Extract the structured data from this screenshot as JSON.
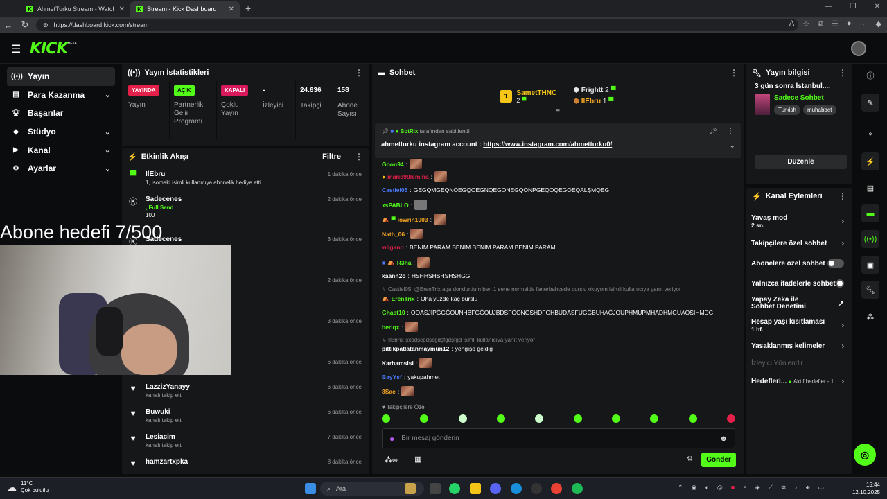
{
  "browser": {
    "tabs": [
      {
        "title": "AhmetTurku Stream - Watch Live",
        "active": false
      },
      {
        "title": "Stream - Kick Dashboard",
        "active": true
      }
    ],
    "url": "https://dashboard.kick.com/stream"
  },
  "brand": {
    "logo": "KICK",
    "beta": "BETA",
    "accent": "#53fc18"
  },
  "sidebar": {
    "items": [
      {
        "label": "Yayın",
        "icon": "broadcast-icon",
        "active": true,
        "chevron": false
      },
      {
        "label": "Para Kazanma",
        "icon": "money-icon",
        "chevron": true
      },
      {
        "label": "Başarılar",
        "icon": "trophy-icon",
        "chevron": false
      },
      {
        "label": "Stüdyo",
        "icon": "studio-icon",
        "chevron": true
      },
      {
        "label": "Kanal",
        "icon": "channel-icon",
        "chevron": true
      },
      {
        "label": "Ayarlar",
        "icon": "gear-icon",
        "chevron": true
      }
    ]
  },
  "stats": {
    "title": "Yayın İstatistikleri",
    "items": [
      {
        "value": "YAYINDA",
        "label": "Yayın",
        "badge": "red"
      },
      {
        "value": "AÇIK",
        "label": "Partnerlik Gelir Programı",
        "badge": "green"
      },
      {
        "value": "KAPALI",
        "label": "Çoklu Yayın",
        "badge": "red2"
      },
      {
        "value": "-",
        "label": "İzleyici"
      },
      {
        "value": "24.636",
        "label": "Takipçi"
      },
      {
        "value": "158",
        "label": "Abone Sayısı"
      }
    ]
  },
  "activity": {
    "title": "Etkinlik Akışı",
    "filter": "Filtre",
    "items": [
      {
        "name": "IlEbru",
        "desc": "1, isomaki isimli kullanıcıya abonelik hediye etti.",
        "time": "1 dakika önce",
        "icon": "gift-icon"
      },
      {
        "name": "Sadecenes",
        "desc": ", Full Send",
        "extra": "100",
        "time": "2 dakika önce",
        "icon": "kick-icon"
      },
      {
        "name": "Sadecenes",
        "desc": "",
        "time": "3 dakika önce",
        "icon": "kick-icon"
      },
      {
        "name": "",
        "desc": "",
        "time": "2 dakika önce",
        "icon": "heart-icon"
      },
      {
        "name": "",
        "desc": "",
        "time": "3 dakika önce",
        "icon": "heart-icon"
      },
      {
        "name": "",
        "desc": "kanalı takip etti",
        "time": "6 dakika önce",
        "icon": "heart-icon"
      },
      {
        "name": "LazzizYanayy",
        "desc": "kanalı takip etti",
        "time": "6 dakika önce",
        "icon": "heart-icon"
      },
      {
        "name": "Buwuki",
        "desc": "kanalı takip etti",
        "time": "6 dakika önce",
        "icon": "heart-icon"
      },
      {
        "name": "Lesiacim",
        "desc": "kanalı takip etti",
        "time": "7 dakika önce",
        "icon": "heart-icon"
      },
      {
        "name": "hamzartxpka",
        "desc": "",
        "time": "8 dakika önce",
        "icon": "heart-icon"
      }
    ]
  },
  "overlay": {
    "goal_text": "Abone hedefi 7/500"
  },
  "chat": {
    "title": "Sohbet",
    "podium": [
      {
        "rank": "1",
        "name": "SametTHNC",
        "count": "2"
      },
      {
        "rank": "2",
        "name": "Frightt",
        "count": "2"
      },
      {
        "rank": "3",
        "name": "IlEbru",
        "count": "1"
      }
    ],
    "pinned": {
      "by": "BotRix",
      "by_suffix": "tarafından sabitlendi",
      "text": "ahmetturku instagram account : ",
      "link": "https://www.instagram.com/ahmetturku0/"
    },
    "messages": [
      {
        "user": "Goon94",
        "color": "#53fc18",
        "text": "",
        "emote": true
      },
      {
        "user": "mario99lemina",
        "color": "#e2204a",
        "text": "",
        "emote": true
      },
      {
        "user": "Castiel05",
        "color": "#4a7bff",
        "text": "GEGQMGEQNOEGQOEGNQEGONEGQONPGEQOQEGOEQALŞMQEG",
        "emote": false
      },
      {
        "user": "xsPABLO",
        "color": "#53fc18",
        "text": "",
        "emote": true
      },
      {
        "user": "lowrin1003",
        "color": "#f5a623",
        "text": "",
        "emote": true
      },
      {
        "user": "Nath_06",
        "color": "#f5a623",
        "text": "",
        "emote": true
      },
      {
        "user": "wilgano",
        "color": "#e2204a",
        "text": "BENİM PARAM BENİM BENİM PARAM BENİM PARAM",
        "emote": false
      },
      {
        "user": "R3ha",
        "color": "#53fc18",
        "text": "",
        "emote": true
      },
      {
        "user": "kaann2o",
        "color": "#ffffff",
        "text": "HSHHSHSHSHSHGG",
        "emote": false
      },
      {
        "user": "ErenTrix",
        "color": "#53fc18",
        "text": "Oha yüzde kaç burslu",
        "emote": false
      },
      {
        "user": "Ghast10",
        "color": "#53fc18",
        "text": "OOASJIPĞGĞOUNHBFGĞOUJBDSFĞONGSHDFGHBUDASFUGĞBUHAĞJOUPHMUPMHADHMGUAOSIHMDG",
        "emote": false
      },
      {
        "user": "beriqx",
        "color": "#53fc18",
        "text": "",
        "emote": true
      },
      {
        "user": "pittikpatlatanmaymun12",
        "color": "#ffffff",
        "text": "yengişo geldiğ",
        "emote": false
      },
      {
        "user": "Karhamsisi",
        "color": "#ffffff",
        "text": "",
        "emote": true
      },
      {
        "user": "BayYsf",
        "color": "#4a7bff",
        "text": "yakupahmet",
        "emote": false
      },
      {
        "user": "8Sae",
        "color": "#f5a623",
        "text": "",
        "emote": true
      }
    ],
    "replies": [
      "Castiel05: @ErenTrix aga dondurdum ben 1 sene normalde fenerbahcede burslu okuyom isimli kullanıcıya yanıt veriyor",
      "IlEbru: şxpdşcpdşcğdşfğdşfğd isimli kullanıcıya yanıt veriyor"
    ],
    "mode_label": "Takipçilere Özel",
    "placeholder": "Bir mesaj gönderin",
    "send_label": "Gönder"
  },
  "stream_info": {
    "title": "Yayın bilgisi",
    "stream_title": "3 gün sonra İstanbul....",
    "category": "Sadece Sohbet",
    "tags": [
      "Turkish",
      "muhabbet"
    ],
    "edit_label": "Düzenle"
  },
  "channel_actions": {
    "title": "Kanal Eylemleri",
    "items": [
      {
        "label": "Yavaş mod",
        "sub": "2 sn.",
        "control": "chevron"
      },
      {
        "label": "Takipçilere özel sohbet",
        "sub": "",
        "control": "chevron"
      },
      {
        "label": "Abonelere özel sohbet",
        "sub": "",
        "control": "toggle"
      },
      {
        "label": "Yalnızca ifadelerle sohbet",
        "sub": "",
        "control": "toggle"
      },
      {
        "label": "Yapay Zeka ile Sohbet Denetimi",
        "sub": "",
        "control": "external"
      },
      {
        "label": "Hesap yaşı kısıtlaması",
        "sub": "1 hf.",
        "control": "chevron"
      },
      {
        "label": "Yasaklanmış kelimeler",
        "sub": "",
        "control": "chevron"
      },
      {
        "label": "İzleyici Yönlendir",
        "sub": "",
        "control": "disabled"
      },
      {
        "label": "Hedefleri...",
        "sub": "",
        "extra": "Aktif hedefler - 1",
        "control": "chevron"
      }
    ]
  },
  "taskbar": {
    "weather_temp": "11°C",
    "weather_desc": "Çok bulutlu",
    "search": "Ara",
    "time": "15:44",
    "date": "12.10.2025"
  }
}
